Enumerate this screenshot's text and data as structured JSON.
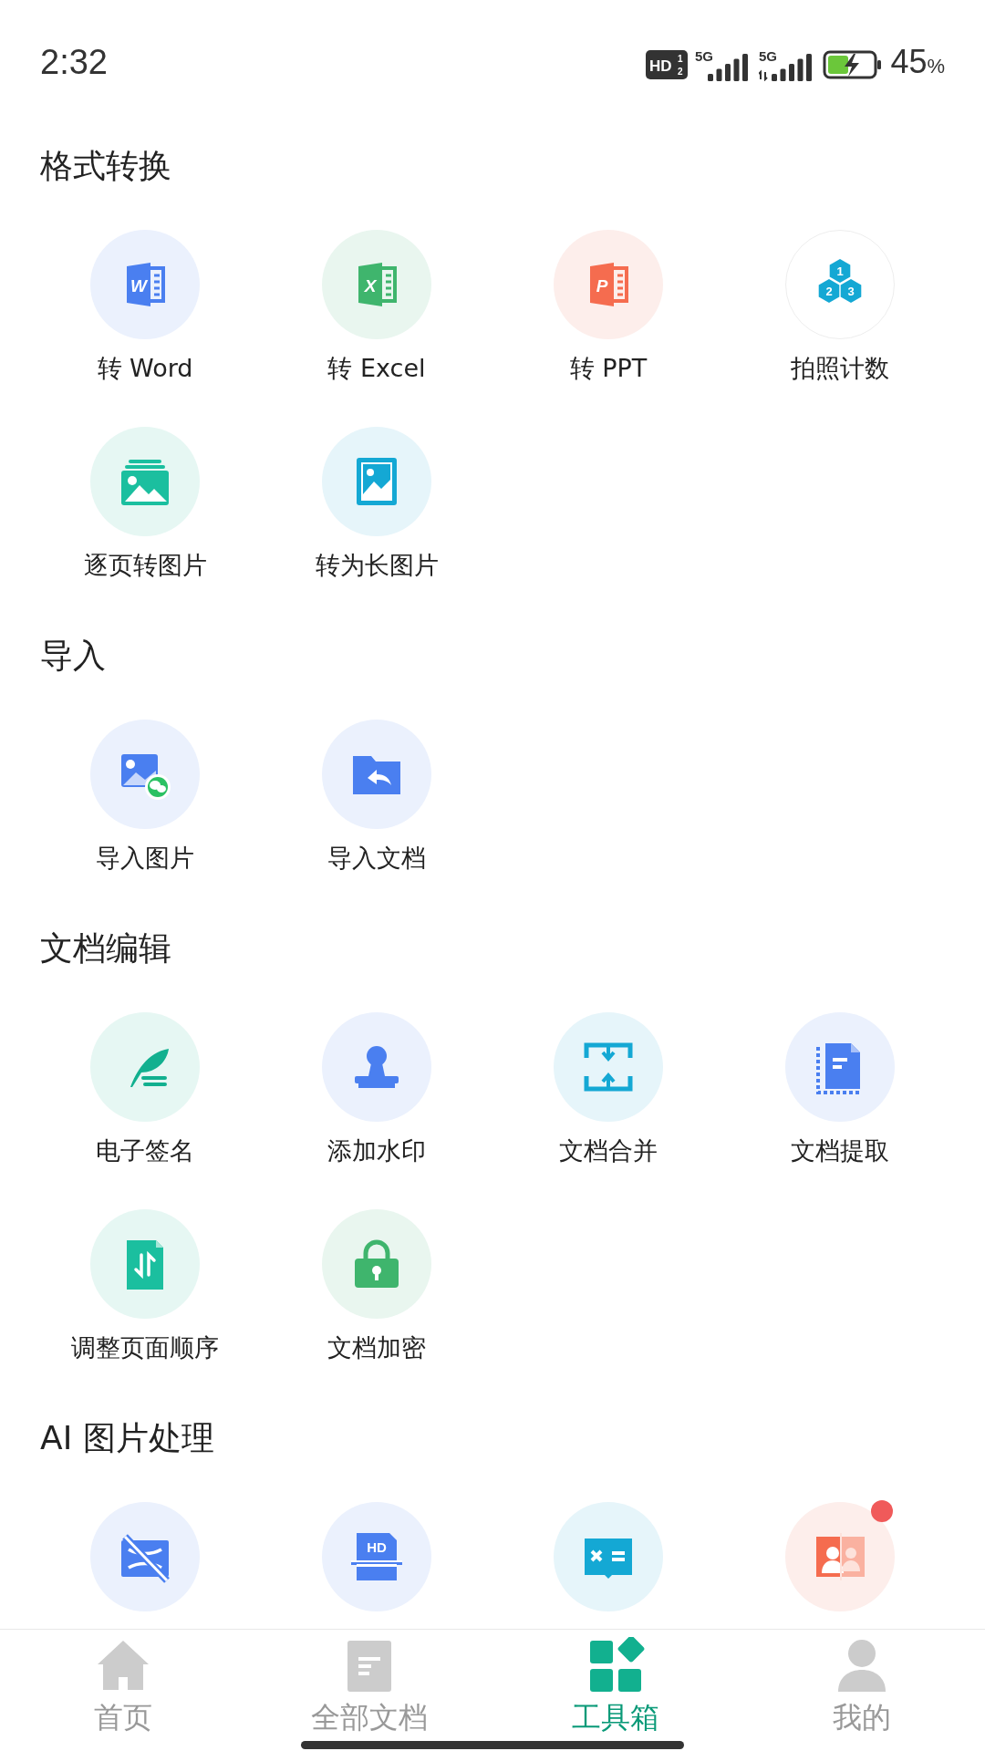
{
  "status_bar": {
    "time": "2:32",
    "hd_label": "HD",
    "hd_marks": [
      "1",
      "2"
    ],
    "network_labels": [
      "5G",
      "5G"
    ],
    "battery": "45",
    "battery_unit": "%"
  },
  "sections": [
    {
      "title": "格式转换",
      "items": [
        {
          "kind": "word",
          "label": "转 Word",
          "icon_text": "W"
        },
        {
          "kind": "excel",
          "label": "转 Excel",
          "icon_text": "X"
        },
        {
          "kind": "ppt",
          "label": "转 PPT",
          "icon_text": "P"
        },
        {
          "kind": "count",
          "label": "拍照计数",
          "icon_digits": [
            "1",
            "2",
            "3"
          ]
        },
        {
          "kind": "pages",
          "label": "逐页转图片"
        },
        {
          "kind": "long",
          "label": "转为长图片"
        }
      ]
    },
    {
      "title": "导入",
      "items": [
        {
          "kind": "import_image",
          "label": "导入图片"
        },
        {
          "kind": "import_doc",
          "label": "导入文档"
        }
      ]
    },
    {
      "title": "文档编辑",
      "items": [
        {
          "kind": "sign",
          "label": "电子签名"
        },
        {
          "kind": "watermark",
          "label": "添加水印"
        },
        {
          "kind": "merge",
          "label": "文档合并"
        },
        {
          "kind": "extract",
          "label": "文档提取"
        },
        {
          "kind": "reorder",
          "label": "调整页面顺序"
        },
        {
          "kind": "encrypt",
          "label": "文档加密"
        }
      ]
    },
    {
      "title": "AI 图片处理",
      "items": [
        {
          "kind": "remove"
        },
        {
          "kind": "hd",
          "icon_text": "HD"
        },
        {
          "kind": "formula"
        },
        {
          "kind": "portrait",
          "new_dot": true
        }
      ]
    }
  ],
  "tabs": [
    {
      "kind": "home",
      "label": "首页",
      "selected": false
    },
    {
      "kind": "docs",
      "label": "全部文档",
      "selected": false
    },
    {
      "kind": "tools",
      "label": "工具箱",
      "selected": true
    },
    {
      "kind": "me",
      "label": "我的",
      "selected": false
    }
  ]
}
